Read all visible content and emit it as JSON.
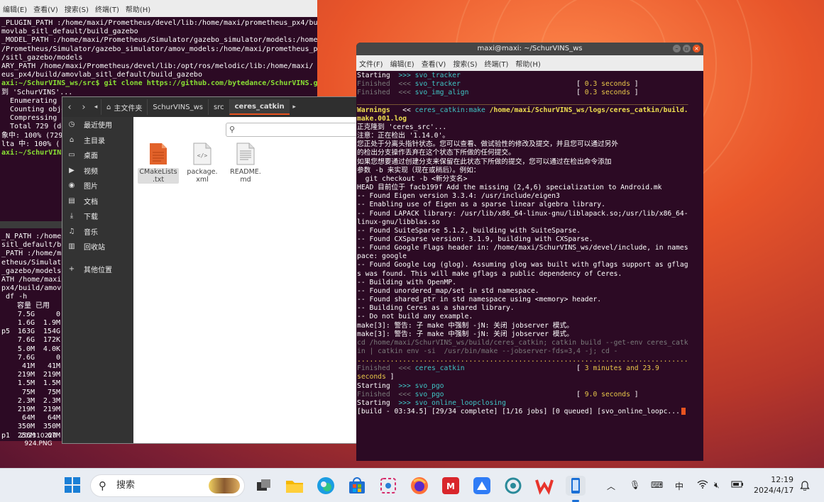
{
  "left_terminal": {
    "menu": [
      "编辑(E)",
      "查看(V)",
      "搜索(S)",
      "终端(T)",
      "帮助(H)"
    ],
    "lines": [
      "_PLUGIN_PATH :/home/maxi/Prometheus/devel/lib:/home/maxi/prometheus_px4/bu",
      "movlab_sitl_default/build_gazebo",
      "_MODEL_PATH :/home/maxi/Prometheus/Simulator/gazebo_simulator/models:/home",
      "/Prometheus/Simulator/gazebo_simulator/amov_models:/home/maxi/prometheus_px",
      "/sitl_gazebo/models",
      "ARY_PATH /home/maxi/Prometheus/devel/lib:/opt/ros/melodic/lib:/home/maxi/",
      "eus_px4/build/amovlab_sitl_default/build_gazebo",
      "axi:~/SchurVINS_ws/src$ git clone https://github.com/bytedance/SchurVINS.g",
      "",
      "到 'SchurVINS'...",
      "  Enumerating ob",
      "  Counting objec",
      "  Compressing ob",
      "  Total 729 (de",
      "象中: 100% (729",
      "lta 中: 100% (",
      "axi:~/SchurVINS"
    ]
  },
  "lower_terminal": {
    "lines": [
      "_N_PATH :/home/m",
      "sitl_default/bu",
      "_PATH :/home/ma",
      "etheus/Simulator/",
      "_gazebo/models",
      "ATH /home/maxi/",
      "px4/build/amovla",
      " df -h"
    ],
    "headers": [
      "容量",
      "已用"
    ],
    "rows": [
      [
        "",
        "7.5G",
        "0"
      ],
      [
        "",
        "1.6G",
        "1.9M"
      ],
      [
        "p5",
        "163G",
        "154G"
      ],
      [
        "",
        "7.6G",
        "172K"
      ],
      [
        "",
        "5.0M",
        "4.0K"
      ],
      [
        "",
        "7.6G",
        "0"
      ],
      [
        "",
        "41M",
        "41M"
      ],
      [
        "",
        "219M",
        "219M"
      ],
      [
        "",
        "1.5M",
        "1.5M"
      ],
      [
        "",
        "75M",
        "75M"
      ],
      [
        "",
        "2.3M",
        "2.3M"
      ],
      [
        "",
        "219M",
        "219M"
      ],
      [
        "",
        "64M",
        "64M"
      ],
      [
        "",
        "350M",
        "350M"
      ],
      [
        "p1",
        "256M",
        "67M"
      ]
    ]
  },
  "files": {
    "breadcrumbs": [
      "主文件夹",
      "SchurVINS_ws",
      "src",
      "ceres_catkin"
    ],
    "sidebar": [
      {
        "icon": "clock-icon",
        "label": "最近使用"
      },
      {
        "icon": "home-icon",
        "label": "主目录"
      },
      {
        "icon": "desktop-icon",
        "label": "桌面"
      },
      {
        "icon": "video-icon",
        "label": "视频"
      },
      {
        "icon": "camera-icon",
        "label": "图片"
      },
      {
        "icon": "document-icon",
        "label": "文档"
      },
      {
        "icon": "download-icon",
        "label": "下载"
      },
      {
        "icon": "music-icon",
        "label": "音乐"
      },
      {
        "icon": "trash-icon",
        "label": "回收站"
      },
      {
        "icon": "plus-icon",
        "label": "其他位置"
      }
    ],
    "items": [
      {
        "name": "CMakeLists\n.txt",
        "icon": "cmake-file-icon"
      },
      {
        "name": "package.\nxml",
        "icon": "xml-file-icon"
      },
      {
        "name": "README.\nmd",
        "icon": "text-file-icon"
      }
    ]
  },
  "main_terminal": {
    "title": "maxi@maxi: ~/SchurVINS_ws",
    "menu": [
      "文件(F)",
      "编辑(E)",
      "查看(V)",
      "搜索(S)",
      "终端(T)",
      "帮助(H)"
    ],
    "lines": [
      [
        {
          "t": "Starting  ",
          "c": ""
        },
        {
          "t": ">>> svo_tracker",
          "c": "c-cyan"
        }
      ],
      [
        {
          "t": "Finished  <<< ",
          "c": "c-gray"
        },
        {
          "t": "svo_tracker",
          "c": "c-cyan"
        },
        {
          "t": "                            [ ",
          "c": ""
        },
        {
          "t": "0.3 seconds",
          "c": "c-wy"
        },
        {
          "t": " ]",
          "c": ""
        }
      ],
      [
        {
          "t": "Finished  <<< ",
          "c": "c-gray"
        },
        {
          "t": "svo_img_align",
          "c": "c-cyan"
        },
        {
          "t": "                          [ ",
          "c": ""
        },
        {
          "t": "0.3 seconds",
          "c": "c-wy"
        },
        {
          "t": " ]",
          "c": ""
        }
      ],
      [
        {
          "t": "",
          "c": ""
        }
      ],
      [
        {
          "t": "________________________________________________________________________________",
          "c": "c-wy"
        }
      ],
      [
        {
          "t": "Warnings",
          "c": "c-y"
        },
        {
          "t": "   << ",
          "c": ""
        },
        {
          "t": "ceres_catkin:make",
          "c": "c-cyan"
        },
        {
          "t": " /home/maxi/SchurVINS_ws/logs/ceres_catkin/build.",
          "c": "c-y"
        }
      ],
      [
        {
          "t": "make.001.log",
          "c": "c-y"
        }
      ],
      [
        {
          "t": "正克隆到 'ceres_src'...",
          "c": ""
        }
      ],
      [
        {
          "t": "注意：正在检出 '1.14.0'。",
          "c": ""
        }
      ],
      [
        {
          "t": "",
          "c": ""
        }
      ],
      [
        {
          "t": "您正处于分离头指针状态。您可以查看、做试验性的修改及提交，并且您可以通过另外",
          "c": ""
        }
      ],
      [
        {
          "t": "的检出分支操作丢弃在这个状态下所做的任何提交。",
          "c": ""
        }
      ],
      [
        {
          "t": "",
          "c": ""
        }
      ],
      [
        {
          "t": "如果您想要通过创建分支来保留在此状态下所做的提交，您可以通过在检出命令添加",
          "c": ""
        }
      ],
      [
        {
          "t": "参数 -b 来实现（现在或稍后）。例如：",
          "c": ""
        }
      ],
      [
        {
          "t": "",
          "c": ""
        }
      ],
      [
        {
          "t": "  git checkout -b <新分支名>",
          "c": ""
        }
      ],
      [
        {
          "t": "",
          "c": ""
        }
      ],
      [
        {
          "t": "HEAD 目前位于 facb199f Add the missing (2,4,6) specialization to Android.mk",
          "c": ""
        }
      ],
      [
        {
          "t": "-- Found Eigen version 3.3.4: /usr/include/eigen3",
          "c": ""
        }
      ],
      [
        {
          "t": "-- Enabling use of Eigen as a sparse linear algebra library.",
          "c": ""
        }
      ],
      [
        {
          "t": "-- Found LAPACK library: /usr/lib/x86_64-linux-gnu/liblapack.so;/usr/lib/x86_64-",
          "c": ""
        }
      ],
      [
        {
          "t": "linux-gnu/libblas.so",
          "c": ""
        }
      ],
      [
        {
          "t": "-- Found SuiteSparse 5.1.2, building with SuiteSparse.",
          "c": ""
        }
      ],
      [
        {
          "t": "-- Found CXSparse version: 3.1.9, building with CXSparse.",
          "c": ""
        }
      ],
      [
        {
          "t": "-- Found Google Flags header in: /home/maxi/SchurVINS_ws/devel/include, in names",
          "c": ""
        }
      ],
      [
        {
          "t": "pace: google",
          "c": ""
        }
      ],
      [
        {
          "t": "-- Found Google Log (glog). Assuming glog was built with gflags support as gflag",
          "c": ""
        }
      ],
      [
        {
          "t": "s was found. This will make gflags a public dependency of Ceres.",
          "c": ""
        }
      ],
      [
        {
          "t": "-- Building with OpenMP.",
          "c": ""
        }
      ],
      [
        {
          "t": "-- Found unordered_map/set in std namespace.",
          "c": ""
        }
      ],
      [
        {
          "t": "-- Found shared_ptr in std namespace using <memory> header.",
          "c": ""
        }
      ],
      [
        {
          "t": "-- Building Ceres as a shared library.",
          "c": ""
        }
      ],
      [
        {
          "t": "-- Do not build any example.",
          "c": ""
        }
      ],
      [
        {
          "t": "make[3]: 警告: 子 make 中强制 -jN: 关闭 jobserver 模式。",
          "c": ""
        }
      ],
      [
        {
          "t": "make[3]: 警告: 子 make 中强制 -jN: 关闭 jobserver 模式。",
          "c": ""
        }
      ],
      [
        {
          "t": "cd /home/maxi/SchurVINS_ws/build/ceres_catkin; catkin build --get-env ceres_catk",
          "c": "c-gray"
        }
      ],
      [
        {
          "t": "in | catkin env -si  /usr/bin/make --jobserver-fds=3,4 -j; cd -",
          "c": "c-gray"
        }
      ],
      [
        {
          "t": "",
          "c": ""
        }
      ],
      [
        {
          "t": "................................................................................",
          "c": "c-wy"
        }
      ],
      [
        {
          "t": "Finished  <<< ",
          "c": "c-gray"
        },
        {
          "t": "ceres_catkin",
          "c": "c-cyan"
        },
        {
          "t": "                           [ ",
          "c": ""
        },
        {
          "t": "3 minutes and 23.9",
          "c": "c-wy"
        }
      ],
      [
        {
          "t": "seconds",
          "c": "c-wy"
        },
        {
          "t": " ]",
          "c": ""
        }
      ],
      [
        {
          "t": "Starting  ",
          "c": ""
        },
        {
          "t": ">>> svo_pgo",
          "c": "c-cyan"
        }
      ],
      [
        {
          "t": "Finished  <<< ",
          "c": "c-gray"
        },
        {
          "t": "svo_pgo",
          "c": "c-cyan"
        },
        {
          "t": "                                [ ",
          "c": ""
        },
        {
          "t": "9.0 seconds",
          "c": "c-wy"
        },
        {
          "t": " ]",
          "c": ""
        }
      ],
      [
        {
          "t": "Starting  ",
          "c": ""
        },
        {
          "t": ">>> svo_online_loopclosing",
          "c": "c-cyan"
        }
      ],
      [
        {
          "t": "[build - 03:34.5] [29/34 complete] [1/16 jobs] [0 queued] [svo_online_loopc...",
          "c": ""
        }
      ]
    ]
  },
  "desktop_icon": {
    "label": "202310220\n924.PNG"
  },
  "taskbar": {
    "search_placeholder": "搜索",
    "clock_time": "12:19",
    "clock_date": "2024/4/17",
    "ime": "中"
  }
}
